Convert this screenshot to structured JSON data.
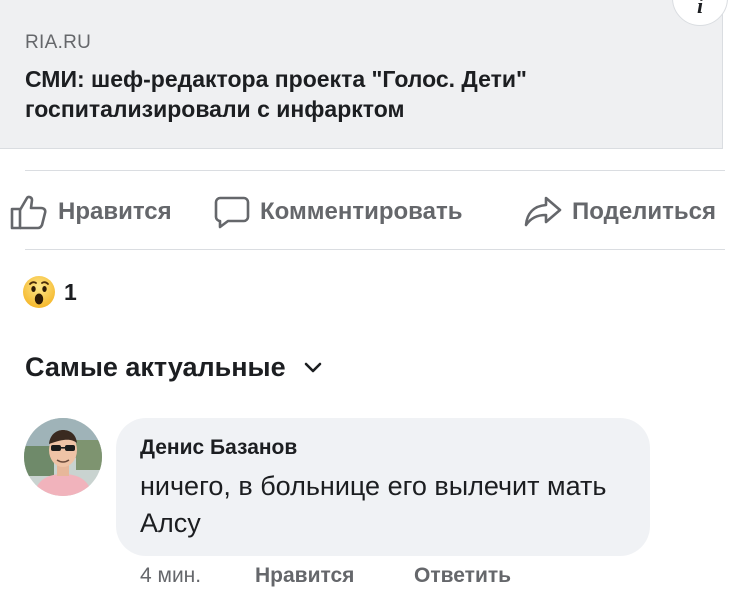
{
  "link_preview": {
    "domain": "RIA.RU",
    "headline": "СМИ: шеф-редактора проекта \"Голос. Дети\" госпитализировали с инфарктом",
    "info_icon": "info-icon",
    "info_glyph": "i"
  },
  "actions": {
    "like_label": "Нравится",
    "comment_label": "Комментировать",
    "share_label": "Поделиться"
  },
  "reactions": {
    "icon": "wow-emoji-icon",
    "count": "1"
  },
  "sort": {
    "label": "Самые актуальные"
  },
  "comment": {
    "author": "Денис Базанов",
    "text": "ничего, в больнице его вылечит мать Алсу",
    "time": "4 мин.",
    "like_label": "Нравится",
    "reply_label": "Ответить"
  },
  "colors": {
    "card_bg": "#eff0f2",
    "bubble_bg": "#f0f2f5",
    "secondary_text": "#65676b",
    "primary_text": "#1c1e21"
  }
}
